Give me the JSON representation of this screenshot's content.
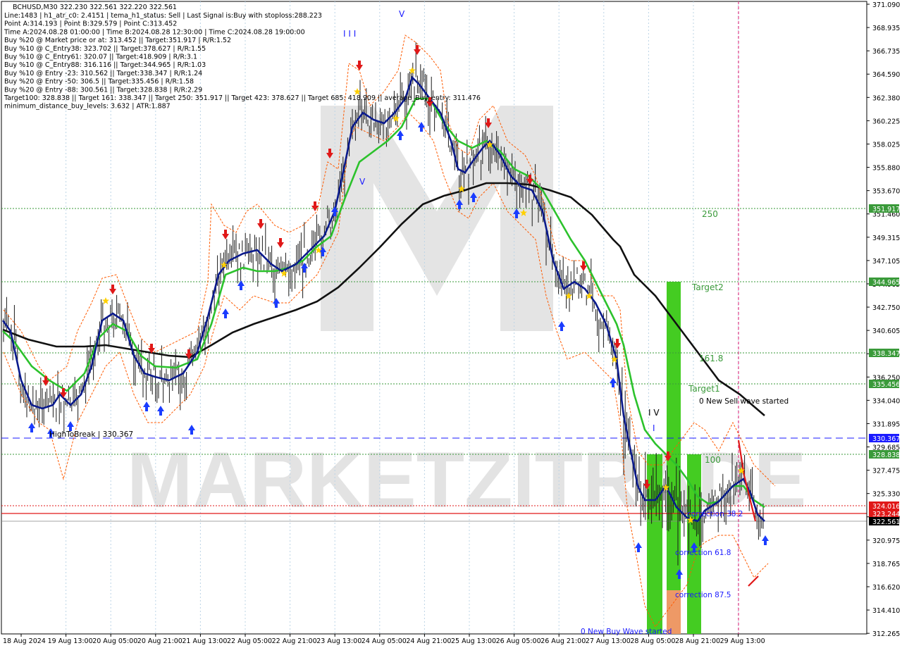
{
  "header": {
    "symbol_line": "BCHUSD,M30  322.230 322.561 322.220 322.561",
    "lines": [
      "Line:1483 | h1_atr_c0: 2.4151 | tema_h1_status: Sell | Last Signal is:Buy with stoploss:288.223",
      "Point A:314.193 | Point B:329.579 | Point C:313.452",
      "Time A:2024.08.28 01:00:00 | Time B:2024.08.28 12:30:00 | Time C:2024.08.28 19:00:00",
      "Buy %20 @ Market price or at: 313.452 || Target:351.917 | R/R:1.52",
      "Buy %10 @ C_Entry38: 323.702 || Target:378.627 | R/R:1.55",
      "Buy %10 @ C_Entry61: 320.07 || Target:418.909 | R/R:3.1",
      "Buy %10 @ C_Entry88: 316.116 || Target:344.965 | R/R:1.03",
      "Buy %10 @ Entry -23: 310.562 || Target:338.347 | R/R:1.24",
      "Buy %20 @ Entry -50: 306.5 || Target:335.456 | R/R:1.58",
      "Buy %20 @ Entry -88: 300.561 || Target:328.838 | R/R:2.29",
      "Target100: 328.838 || Target 161: 338.347 || Target 250: 351.917 || Target 423: 378.627 || Target 685: 418.909 || average_Buy_entry: 311.476",
      "minimum_distance_buy_levels: 3.632 | ATR:1.887"
    ]
  },
  "watermark": "MARKETZITRADE",
  "price_axis": {
    "ticks": [
      "371.090",
      "368.935",
      "366.735",
      "364.590",
      "362.380",
      "360.225",
      "358.025",
      "355.880",
      "353.670",
      "351.460",
      "349.315",
      "347.105",
      "344.965",
      "342.750",
      "340.605",
      "338.395",
      "336.250",
      "334.040",
      "331.895",
      "329.685",
      "327.475",
      "325.330",
      "323.120",
      "320.975",
      "318.765",
      "316.620",
      "314.410",
      "312.265"
    ]
  },
  "time_axis": {
    "ticks": [
      "18 Aug 2024",
      "19 Aug 13:00",
      "20 Aug 05:00",
      "20 Aug 21:00",
      "21 Aug 13:00",
      "22 Aug 05:00",
      "22 Aug 21:00",
      "23 Aug 13:00",
      "24 Aug 05:00",
      "24 Aug 21:00",
      "25 Aug 13:00",
      "26 Aug 05:00",
      "26 Aug 21:00",
      "27 Aug 13:00",
      "28 Aug 05:00",
      "28 Aug 21:00",
      "29 Aug 13:00"
    ]
  },
  "levels": [
    {
      "label": "351.917",
      "color": "#3a9a3a"
    },
    {
      "label": "344.965",
      "color": "#3a9a3a"
    },
    {
      "label": "338.347",
      "color": "#3a9a3a"
    },
    {
      "label": "335.456",
      "color": "#3a9a3a"
    },
    {
      "label": "330.367",
      "color": "#1a1aff"
    },
    {
      "label": "328.838",
      "color": "#3a9a3a"
    },
    {
      "label": "324.016",
      "color": "#e01818"
    },
    {
      "label": "323.244",
      "color": "#e01818"
    },
    {
      "label": "322.561",
      "color": "#000000"
    }
  ],
  "annotations": {
    "level_250": "250",
    "target2": "Target2",
    "level_161": "161.8",
    "target1": "Target1",
    "new_sell_wave": "0 New Sell wave started",
    "level_100": "100",
    "high_to_break": "HighToBreak | 330.367",
    "correction_382": "correction 38.2",
    "correction_618": "correction 61.8",
    "correction_875": "correction 87.5",
    "new_buy_wave": "0 New Buy Wave started",
    "wave_v_top": "V",
    "wave_iii": "I I I",
    "wave_v_mid": "V",
    "wave_iv": "I V",
    "wave_i": "I"
  },
  "colors": {
    "ema_fast": "#0a1a8c",
    "ema_mid": "#2cc22c",
    "ema_slow": "#111111",
    "dashed_orange": "#ff5a00",
    "sell_arrow": "#e01818",
    "buy_arrow": "#1a3cff",
    "zone_green": "#44cc22",
    "zone_orange": "#ee9966",
    "level_green": "#3a9a3a",
    "level_blue": "#1a1aff",
    "level_red": "#e01818"
  }
}
